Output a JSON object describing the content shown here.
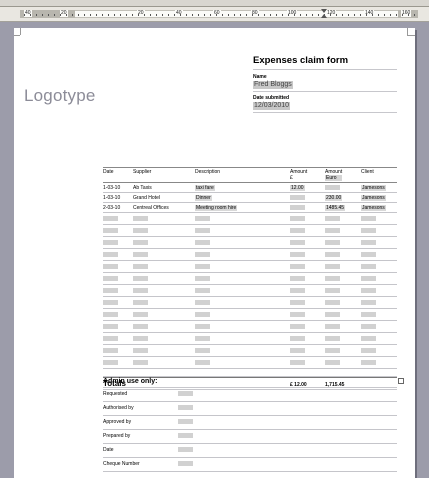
{
  "ruler": {
    "labels": [
      "40",
      "20",
      "20",
      "40",
      "60",
      "80",
      "100",
      "120",
      "140",
      "160"
    ]
  },
  "document": {
    "logo": "Logotype",
    "title": "Expenses claim form",
    "name_label": "Name",
    "name_value": "Fred Bloggs",
    "date_label": "Date submitted",
    "date_value": "12/03/2010",
    "table": {
      "headers": {
        "date": "Date",
        "supplier": "Supplier",
        "description": "Description",
        "amount_gbp": "Amount",
        "amount_gbp_unit": "£",
        "amount_eur": "Amount",
        "amount_eur_unit": "Euro",
        "client": "Client"
      },
      "rows": [
        {
          "date": "1-03-10",
          "supplier": "Ab Taxis",
          "description": "taxi fare",
          "amount_gbp": "12.00",
          "amount_eur": "",
          "client": "Jamesons"
        },
        {
          "date": "1-03-10",
          "supplier": "Grand Hotel",
          "description": "Dinner",
          "amount_gbp": "",
          "amount_eur": "230.00",
          "client": "Jamesons"
        },
        {
          "date": "2-03-10",
          "supplier": "Centreal Offices",
          "description": "Meeting room hire",
          "amount_gbp": "",
          "amount_eur": "1485.45",
          "client": "Jamesons"
        }
      ],
      "blank_row_count": 13,
      "totals_label": "Totals",
      "total_gbp": "£  12.00",
      "total_eur": "1,715.45"
    },
    "admin": {
      "title": "Admin use only:",
      "fields": [
        "Requested",
        "Authorised by",
        "Approved by",
        "Prepared by",
        "Date",
        "Cheque Number"
      ]
    }
  }
}
